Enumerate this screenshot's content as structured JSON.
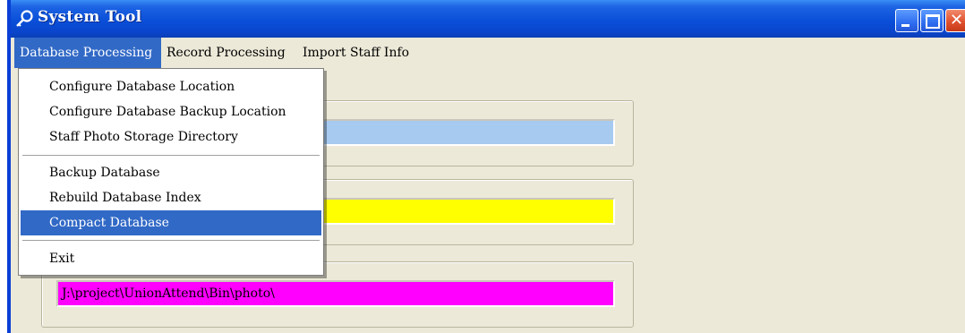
{
  "window": {
    "title": "System Tool",
    "icon": "key-icon",
    "colors": {
      "titlebar": "#0a4fd8",
      "menu_highlight": "#3169c6",
      "field1": "#a6caf0",
      "field2": "#ffff00",
      "field3": "#ff00ff"
    }
  },
  "menubar": {
    "items": [
      {
        "label": "Database Processing"
      },
      {
        "label": "Record Processing"
      },
      {
        "label": "Import Staff Info"
      }
    ]
  },
  "dropdown": {
    "items": [
      {
        "label": "Configure Database Location"
      },
      {
        "label": "Configure Database Backup Location"
      },
      {
        "label": "Staff Photo Storage Directory"
      },
      {
        "label": "Backup Database"
      },
      {
        "label": "Rebuild Database Index"
      },
      {
        "label": "Compact Database"
      },
      {
        "label": "Exit"
      }
    ],
    "highlighted": "Compact Database"
  },
  "fields": {
    "database_location": "",
    "backup_location_visible_tail": "\\",
    "photo_directory": "J:\\project\\UnionAttend\\Bin\\photo\\"
  }
}
